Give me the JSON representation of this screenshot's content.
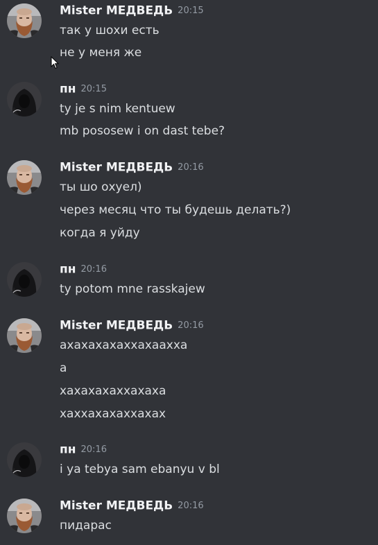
{
  "messages": [
    {
      "author": "Mister МЕДВЕДЬ",
      "time": "20:15",
      "avatar": "bearded-man-avatar",
      "lines": [
        "так у шохи есть",
        "не у меня же"
      ]
    },
    {
      "author": "пн",
      "time": "20:15",
      "avatar": "hooded-figure-avatar",
      "lines": [
        "ty je s nim kentuew",
        "mb pososew i on dast tebe?"
      ]
    },
    {
      "author": "Mister МЕДВЕДЬ",
      "time": "20:16",
      "avatar": "bearded-man-avatar",
      "lines": [
        "ты шо охуел)",
        "через месяц что ты будешь делать?)",
        "когда я уйду"
      ]
    },
    {
      "author": "пн",
      "time": "20:16",
      "avatar": "hooded-figure-avatar",
      "lines": [
        "ty potom mne rasskajew"
      ]
    },
    {
      "author": "Mister МЕДВЕДЬ",
      "time": "20:16",
      "avatar": "bearded-man-avatar",
      "lines": [
        "ахахахахаххахаахха",
        "а",
        "хахахахаххахаха",
        "хаххахахаххахах"
      ]
    },
    {
      "author": "пн",
      "time": "20:16",
      "avatar": "hooded-figure-avatar",
      "lines": [
        "i ya tebya sam ebanyu v bl"
      ]
    },
    {
      "author": "Mister МЕДВЕДЬ",
      "time": "20:16",
      "avatar": "bearded-man-avatar",
      "lines": [
        "пидарас"
      ]
    }
  ],
  "colors": {
    "background": "#313338",
    "username": "#f2f3f5",
    "timestamp": "#949ba4",
    "message_text": "#dbdee1"
  }
}
